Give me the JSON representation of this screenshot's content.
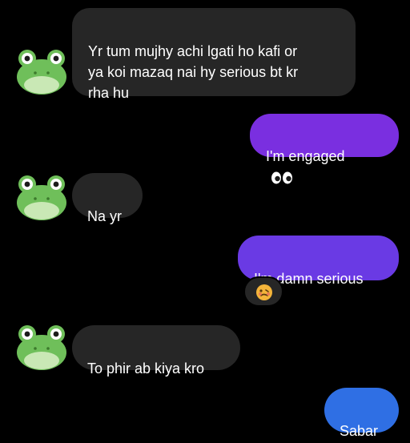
{
  "messages": [
    {
      "sender": "them",
      "text": "Yr tum mujhy achi lgati ho kafi or\nya koi mazaq nai hy serious bt kr\nrha hu"
    },
    {
      "sender": "me",
      "text": "I'm engaged",
      "emoji_icon": "eyes-emoji-icon"
    },
    {
      "sender": "them",
      "text": "Na yr"
    },
    {
      "sender": "me",
      "text": "I'm damn serious",
      "reaction_icon": "woozy-face-emoji-icon"
    },
    {
      "sender": "them",
      "text": "To phir ab kiya kro"
    },
    {
      "sender": "me",
      "text": "Sabar"
    }
  ],
  "colors": {
    "background": "#000000",
    "incoming_bubble": "#262626",
    "outgoing_top": "#7a2fe0",
    "outgoing_mid": "#6a3ae4",
    "outgoing_last": "#2f6fe4",
    "avatar_green": "#6fbf5a"
  }
}
